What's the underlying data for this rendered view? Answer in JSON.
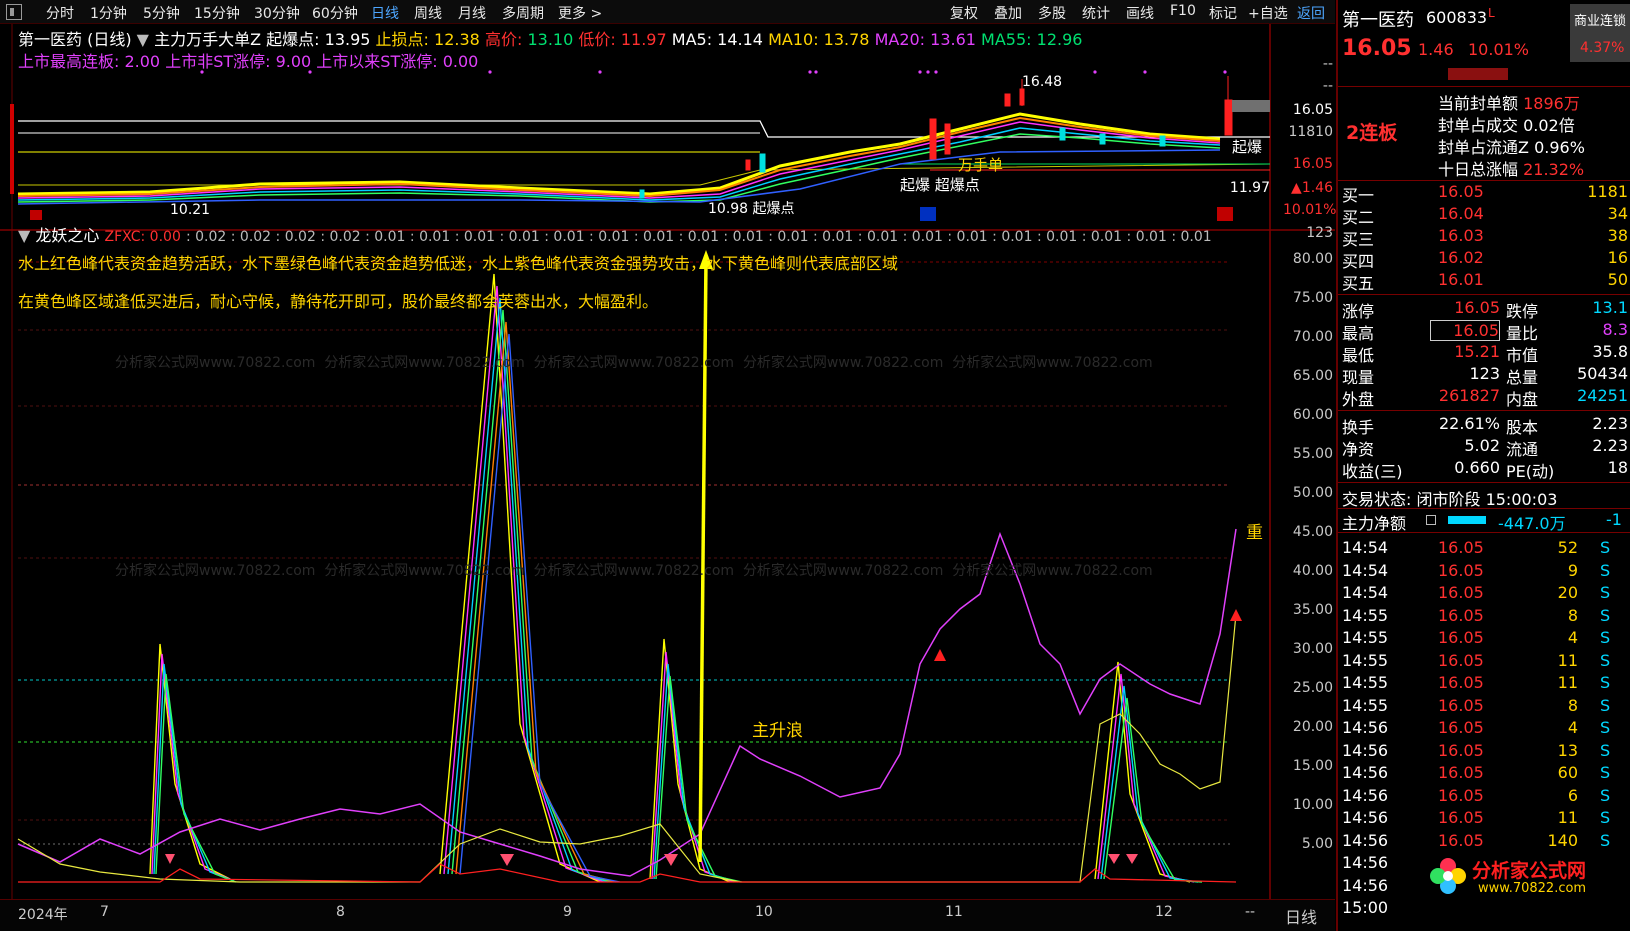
{
  "toolbar": {
    "left_items": [
      "分时",
      "1分钟",
      "5分钟",
      "15分钟",
      "30分钟",
      "60分钟",
      "日线",
      "周线",
      "月线",
      "多周期",
      "更多 >"
    ],
    "active": "日线",
    "right_items": [
      "复权",
      "叠加",
      "多股",
      "统计",
      "画线",
      "F10",
      "标记",
      "+自选",
      "返回"
    ]
  },
  "price_panel": {
    "title": "第一医药 (日线)",
    "indicator": "主力万手大单Z",
    "launch_label": "起爆点:",
    "launch_value": "13.95",
    "stop_label": "止损点:",
    "stop_value": "12.38",
    "high_label": "高价:",
    "high_value": "13.10",
    "low_label": "低价:",
    "low_value": "11.97",
    "ma5": "MA5: 14.14",
    "ma10": "MA10: 13.78",
    "ma20": "MA20: 13.61",
    "ma55": "MA55: 12.96",
    "line2": "上市最高连板: 2.00  上市非ST涨停: 9.00  上市以来ST涨停: 0.00",
    "peak_label": "16.48",
    "low_label2": "10.21",
    "mid_label": "10.98 起爆点",
    "wan_label": "万手单",
    "qibao_label": "起爆 超爆点",
    "qibao_right": "起爆",
    "axis": [
      "--",
      "--",
      "16.05",
      "11810",
      "16.05",
      "11.97",
      "▲1.46",
      "10.01%"
    ]
  },
  "indicator_panel": {
    "name": "龙妖之心",
    "zfxc": "ZFXC: 0.00",
    "values": ": 0.02 : 0.02 : 0.02 : 0.02 : 0.01 : 0.01 : 0.01 : 0.01 : 0.01 : 0.01 : 0.01 : 0.01 : 0.01 : 0.01 : 0.01 : 0.01 : 0.01 : 0.01 : 0.01 : 0.01 : 0.01 : 0.01 : 0.01",
    "desc1": "水上红色峰代表资金趋势活跃，水下墨绿色峰代表资金趋势低迷，水上紫色峰代表资金强势攻击，水下黄色峰则代表底部区域",
    "desc2": "在黄色峰区域逢低买进后，耐心守候，静待花开即可，股价最终都会芙蓉出水，大幅盈利。",
    "annot_main_wave": "主升浪",
    "annot_right": "重",
    "axis_top": "123",
    "axis": [
      "80.00",
      "75.00",
      "70.00",
      "65.00",
      "60.00",
      "55.00",
      "50.00",
      "45.00",
      "40.00",
      "35.00",
      "30.00",
      "25.00",
      "20.00",
      "15.00",
      "10.00",
      "5.00"
    ],
    "watermark": "分析家公式网www.70822.com"
  },
  "bottom": {
    "year": "2024年",
    "months": [
      "7",
      "8",
      "9",
      "10",
      "11",
      "12",
      "--"
    ],
    "period": "日线"
  },
  "side": {
    "name": "第一医药",
    "code": "600833",
    "tag": "L",
    "badge": "商业连锁",
    "badge_pct": "4.37%",
    "price": "16.05",
    "change": "1.46",
    "change_pct": "10.01%",
    "streak": "2连板",
    "seal_lines": [
      {
        "label": "当前封单额",
        "value": "1896万"
      },
      {
        "label": "封单占成交",
        "value": "0.02倍"
      },
      {
        "label": "封单占流通Z",
        "value": "0.96%"
      },
      {
        "label": "十日总涨幅",
        "value": "21.32%"
      }
    ],
    "bids": [
      {
        "label": "买一",
        "price": "16.05",
        "vol": "1181"
      },
      {
        "label": "买二",
        "price": "16.04",
        "vol": "34"
      },
      {
        "label": "买三",
        "price": "16.03",
        "vol": "38"
      },
      {
        "label": "买四",
        "price": "16.02",
        "vol": "16"
      },
      {
        "label": "买五",
        "price": "16.01",
        "vol": "50"
      }
    ],
    "stats": [
      {
        "l1": "涨停",
        "v1": "16.05",
        "l2": "跌停",
        "v2": "13.1"
      },
      {
        "l1": "最高",
        "v1": "16.05",
        "l2": "量比",
        "v2": "8.3"
      },
      {
        "l1": "最低",
        "v1": "15.21",
        "l2": "市值",
        "v2": "35.8"
      },
      {
        "l1": "现量",
        "v1": "123",
        "l2": "总量",
        "v2": "50434"
      },
      {
        "l1": "外盘",
        "v1": "261827",
        "l2": "内盘",
        "v2": "24251"
      },
      {
        "l1": "换手",
        "v1": "22.61%",
        "l2": "股本",
        "v2": "2.23"
      },
      {
        "l1": "净资",
        "v1": "5.02",
        "l2": "流通",
        "v2": "2.23"
      },
      {
        "l1": "收益(三)",
        "v1": "0.660",
        "l2": "PE(动)",
        "v2": "18"
      }
    ],
    "trade_status": "交易状态: 闭市阶段 15:00:03",
    "net_label": "主力净额",
    "net_value": "-447.0万",
    "net_extra": "-1",
    "ticks": [
      {
        "t": "14:54",
        "p": "16.05",
        "v": "52",
        "s": "S"
      },
      {
        "t": "14:54",
        "p": "16.05",
        "v": "9",
        "s": "S"
      },
      {
        "t": "14:54",
        "p": "16.05",
        "v": "20",
        "s": "S"
      },
      {
        "t": "14:55",
        "p": "16.05",
        "v": "8",
        "s": "S"
      },
      {
        "t": "14:55",
        "p": "16.05",
        "v": "4",
        "s": "S"
      },
      {
        "t": "14:55",
        "p": "16.05",
        "v": "11",
        "s": "S"
      },
      {
        "t": "14:55",
        "p": "16.05",
        "v": "11",
        "s": "S"
      },
      {
        "t": "14:55",
        "p": "16.05",
        "v": "8",
        "s": "S"
      },
      {
        "t": "14:56",
        "p": "16.05",
        "v": "4",
        "s": "S"
      },
      {
        "t": "14:56",
        "p": "16.05",
        "v": "13",
        "s": "S"
      },
      {
        "t": "14:56",
        "p": "16.05",
        "v": "60",
        "s": "S"
      },
      {
        "t": "14:56",
        "p": "16.05",
        "v": "6",
        "s": "S"
      },
      {
        "t": "14:56",
        "p": "16.05",
        "v": "11",
        "s": "S"
      },
      {
        "t": "14:56",
        "p": "16.05",
        "v": "140",
        "s": "S"
      },
      {
        "t": "14:56",
        "p": "",
        "v": "",
        "s": ""
      },
      {
        "t": "14:56",
        "p": "",
        "v": "",
        "s": ""
      },
      {
        "t": "15:00",
        "p": "",
        "v": "",
        "s": ""
      }
    ],
    "logo_text": "分析家公式网",
    "logo_url": "www.70822.com"
  }
}
